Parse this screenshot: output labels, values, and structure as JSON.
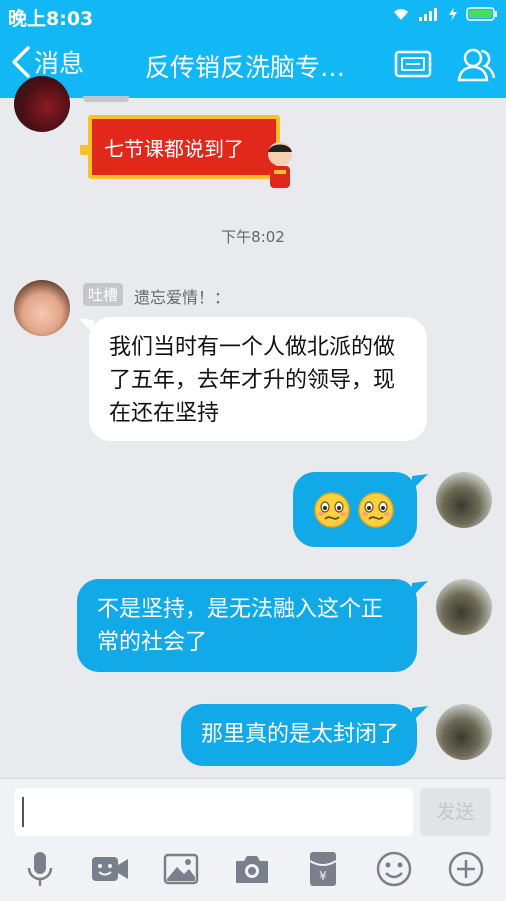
{
  "status": {
    "time": "晚上8:03"
  },
  "header": {
    "back_label": "消息",
    "title": "反传销反洗脑专…"
  },
  "messages": {
    "sticker_text": "七节课都说到了",
    "timestamp": "下午8:02",
    "incoming_tag": "吐槽",
    "incoming_sender": "遗忘爱情！：",
    "incoming_lines": [
      "我们当时有一个人做北派的做",
      "了五年，去年才升的领导，现",
      "在还在坚持"
    ],
    "out2_lines": [
      "不是坚持，是无法融入这个正",
      "常的社会了"
    ],
    "out3_text": "那里真的是太封闭了"
  },
  "input": {
    "value": "",
    "send_label": "发送"
  },
  "toolbar": {
    "icons": [
      "mic-icon",
      "video-icon",
      "image-icon",
      "camera-icon",
      "red-packet-icon",
      "emoji-icon",
      "plus-icon"
    ]
  },
  "colors": {
    "accent": "#12b7f5",
    "bubble_out": "#12a9e8",
    "background": "#e9eaee"
  }
}
